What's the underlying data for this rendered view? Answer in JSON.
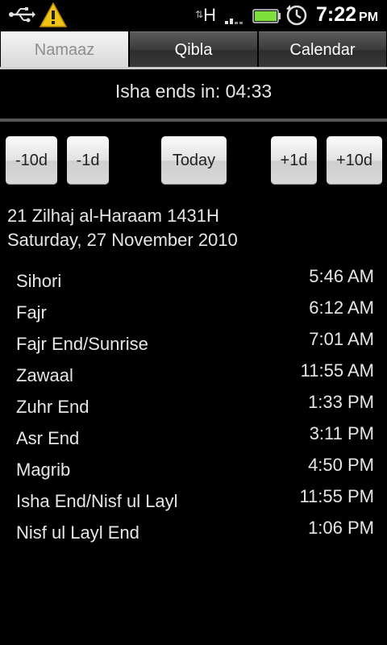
{
  "status_bar": {
    "network_type": "H",
    "clock_time": "7:22",
    "clock_ampm": "PM",
    "icons": [
      "usb-icon",
      "warning-icon",
      "signal-icon",
      "battery-icon",
      "alarm-icon"
    ],
    "battery_color": "#7ee03a",
    "warning_color": "#f0c419"
  },
  "tabs": [
    {
      "label": "Namaaz",
      "active": true
    },
    {
      "label": "Qibla",
      "active": false
    },
    {
      "label": "Calendar",
      "active": false
    }
  ],
  "countdown": "Isha ends in: 04:33",
  "nav_buttons": {
    "minus10": "-10d",
    "minus1": "-1d",
    "today": "Today",
    "plus1": "+1d",
    "plus10": "+10d"
  },
  "dates": {
    "hijri": "21 Zilhaj al-Haraam 1431H",
    "gregorian": "Saturday, 27 November 2010"
  },
  "prayer_times": [
    {
      "name": "Sihori",
      "time": "5:46 AM"
    },
    {
      "name": "Fajr",
      "time": "6:12 AM"
    },
    {
      "name": "Fajr End/Sunrise",
      "time": "7:01 AM"
    },
    {
      "name": "Zawaal",
      "time": "11:55 AM"
    },
    {
      "name": "Zuhr End",
      "time": "1:33 PM"
    },
    {
      "name": "Asr End",
      "time": "3:11 PM"
    },
    {
      "name": "Magrib",
      "time": "4:50 PM"
    },
    {
      "name": "Isha End/Nisf ul Layl",
      "time": "11:55 PM"
    },
    {
      "name": "Nisf ul Layl End",
      "time": "1:06 PM"
    }
  ]
}
